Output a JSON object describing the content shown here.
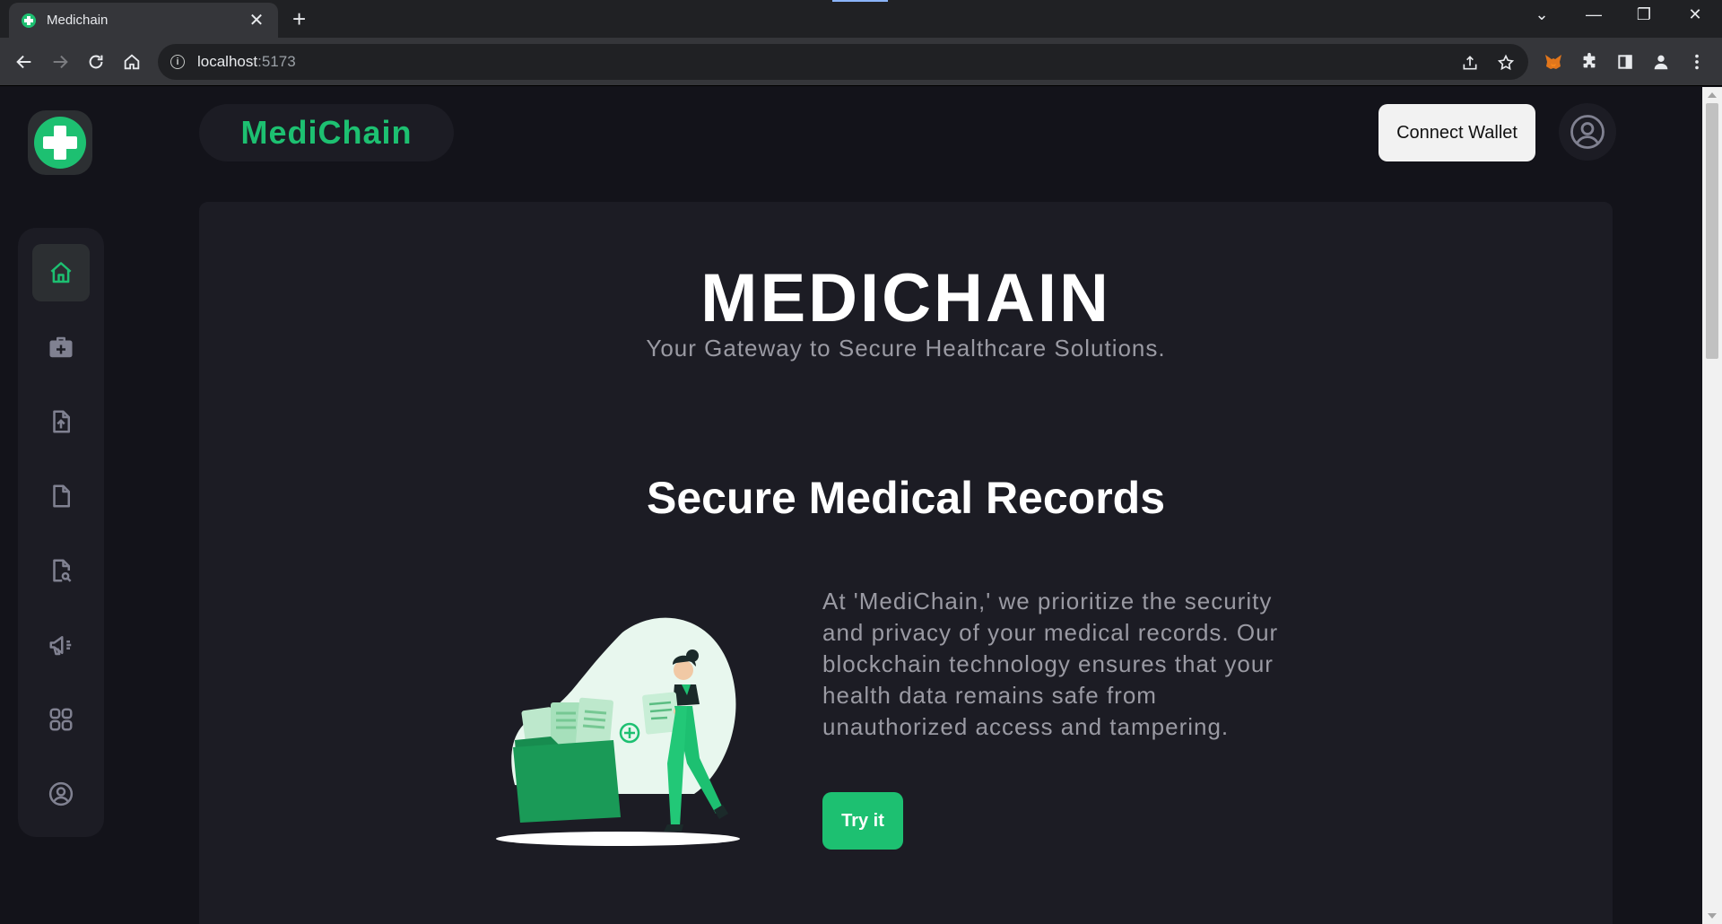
{
  "browser": {
    "tab_title": "Medichain",
    "tab_close": "✕",
    "new_tab": "+",
    "url_host": "localhost",
    "url_port": ":5173",
    "window_controls": {
      "dropdown": "⌄",
      "minimize": "—",
      "restore": "❐",
      "close": "✕"
    }
  },
  "app": {
    "brand": "MediChain",
    "connect_wallet": "Connect Wallet",
    "accent_color": "#1dc071",
    "sidebar_icons": [
      "home-icon",
      "medical-kit-icon",
      "file-upload-icon",
      "file-icon",
      "file-search-icon",
      "megaphone-icon",
      "apps-grid-icon",
      "profile-icon"
    ]
  },
  "hero": {
    "title": "MEDICHAIN",
    "subtitle": "Your Gateway to Secure Healthcare Solutions."
  },
  "section": {
    "title": "Secure Medical Records",
    "description": "At 'MediChain,' we prioritize the security and privacy of your medical records. Our blockchain technology ensures that your health data remains safe from unauthorized access and tampering.",
    "button": "Try it"
  }
}
